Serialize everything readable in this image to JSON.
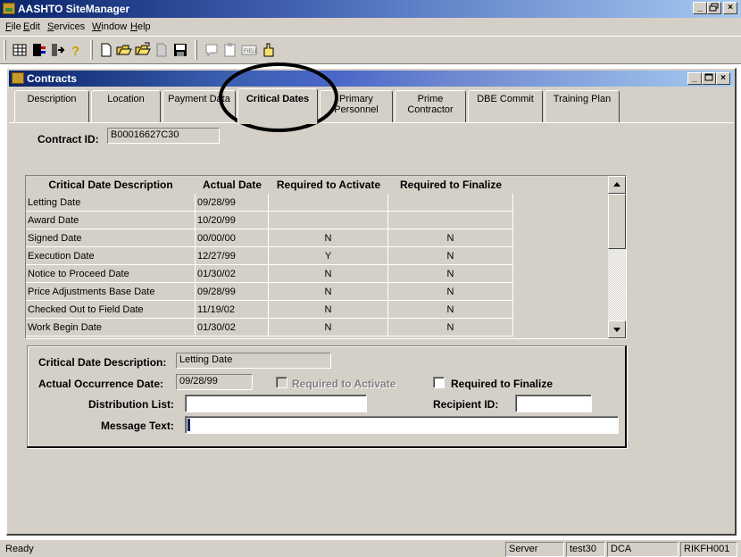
{
  "app": {
    "title": "AASHTO SiteManager"
  },
  "window_buttons": {
    "minimize": "_",
    "restore": "И",
    "close": "×"
  },
  "menu": [
    {
      "label": "File",
      "underline": "F",
      "rest": "ile"
    },
    {
      "label": "Edit",
      "underline": "E",
      "rest": "dit"
    },
    {
      "label": "Services",
      "underline": "S",
      "rest": "ervices"
    },
    {
      "label": "Window",
      "underline": "W",
      "rest": "indow"
    },
    {
      "label": "Help",
      "underline": "H",
      "rest": "elp"
    }
  ],
  "toolbar": {
    "icons": [
      "grid-icon",
      "switchboard-icon",
      "exit-door-icon",
      "help-icon",
      "new-document-icon",
      "open-folder-icon",
      "open-folder-alt-icon",
      "delete-icon",
      "save-icon",
      "comment-icon",
      "clipboard-icon",
      "fields-icon",
      "pointing-hand-icon"
    ]
  },
  "contracts": {
    "title": "Contracts",
    "tabs": [
      {
        "label": "Description"
      },
      {
        "label": "Location"
      },
      {
        "label": "Payment Data"
      },
      {
        "label": "Critical Dates",
        "active": true
      },
      {
        "label": "Primary Personnel"
      },
      {
        "label": "Prime Contractor"
      },
      {
        "label": "DBE Commit"
      },
      {
        "label": "Training Plan"
      }
    ],
    "contract_id_label": "Contract ID:",
    "contract_id_value": "B00016627C30",
    "grid": {
      "headers": [
        "Critical Date Description",
        "Actual Date",
        "Required to Activate",
        "Required to Finalize"
      ],
      "rows": [
        [
          "Letting Date",
          "09/28/99",
          "",
          ""
        ],
        [
          "Award Date",
          "10/20/99",
          "",
          ""
        ],
        [
          "Signed Date",
          "00/00/00",
          "N",
          "N"
        ],
        [
          "Execution Date",
          "12/27/99",
          "Y",
          "N"
        ],
        [
          "Notice to Proceed Date",
          "01/30/02",
          "N",
          "N"
        ],
        [
          "Price Adjustments Base Date",
          "09/28/99",
          "N",
          "N"
        ],
        [
          "Checked Out to Field Date",
          "11/19/02",
          "N",
          "N"
        ],
        [
          "Work Begin Date",
          "01/30/02",
          "N",
          "N"
        ]
      ]
    },
    "detail": {
      "desc_label": "Critical Date Description:",
      "desc_value": "Letting Date",
      "actual_label": "Actual Occurrence Date:",
      "actual_value": "09/28/99",
      "req_activate_label": "Required to Activate",
      "req_finalize_label": "Required to Finalize",
      "dist_label": "Distribution List:",
      "dist_value": "",
      "recipient_label": "Recipient ID:",
      "recipient_value": "",
      "message_label": "Message Text:",
      "message_value": ""
    }
  },
  "status": {
    "text": "Ready",
    "server": "Server",
    "db": "test30",
    "user_type": "DCA",
    "user": "RIKFH001"
  },
  "colors": {
    "face": "#d4d0c8",
    "title_active": "#0a246a",
    "annotation": "#000000"
  }
}
